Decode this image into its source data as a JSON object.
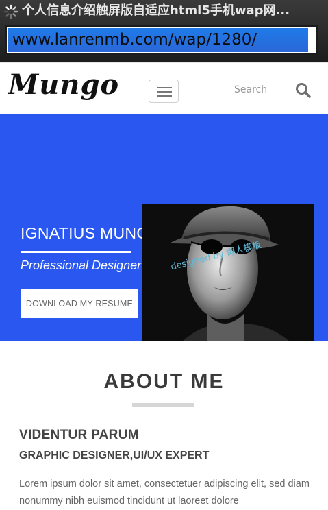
{
  "browser": {
    "tab_title": "个人信息介绍触屏版自适应html5手机wap网...",
    "url": "www.lanrenmb.com/wap/1280/"
  },
  "header": {
    "logo": "Mungo",
    "search_placeholder": "Search"
  },
  "hero": {
    "name": "IGNATIUS MUNGO",
    "role": "Professional Designer",
    "resume_button": "DOWNLOAD MY RESUME",
    "watermark": "designed by 懒人模板",
    "background_color": "#2957f0"
  },
  "about": {
    "title": "ABOUT ME",
    "name": "VIDENTUR PARUM",
    "role": "GRAPHIC DESIGNER,UI/UX EXPERT",
    "text": "Lorem ipsum dolor sit amet, consectetuer adipiscing elit, sed diam nonummy nibh euismod tincidunt ut laoreet dolore"
  },
  "icons": {
    "loading": "loading-spinner-icon",
    "menu": "hamburger-menu-icon",
    "search": "search-icon"
  }
}
